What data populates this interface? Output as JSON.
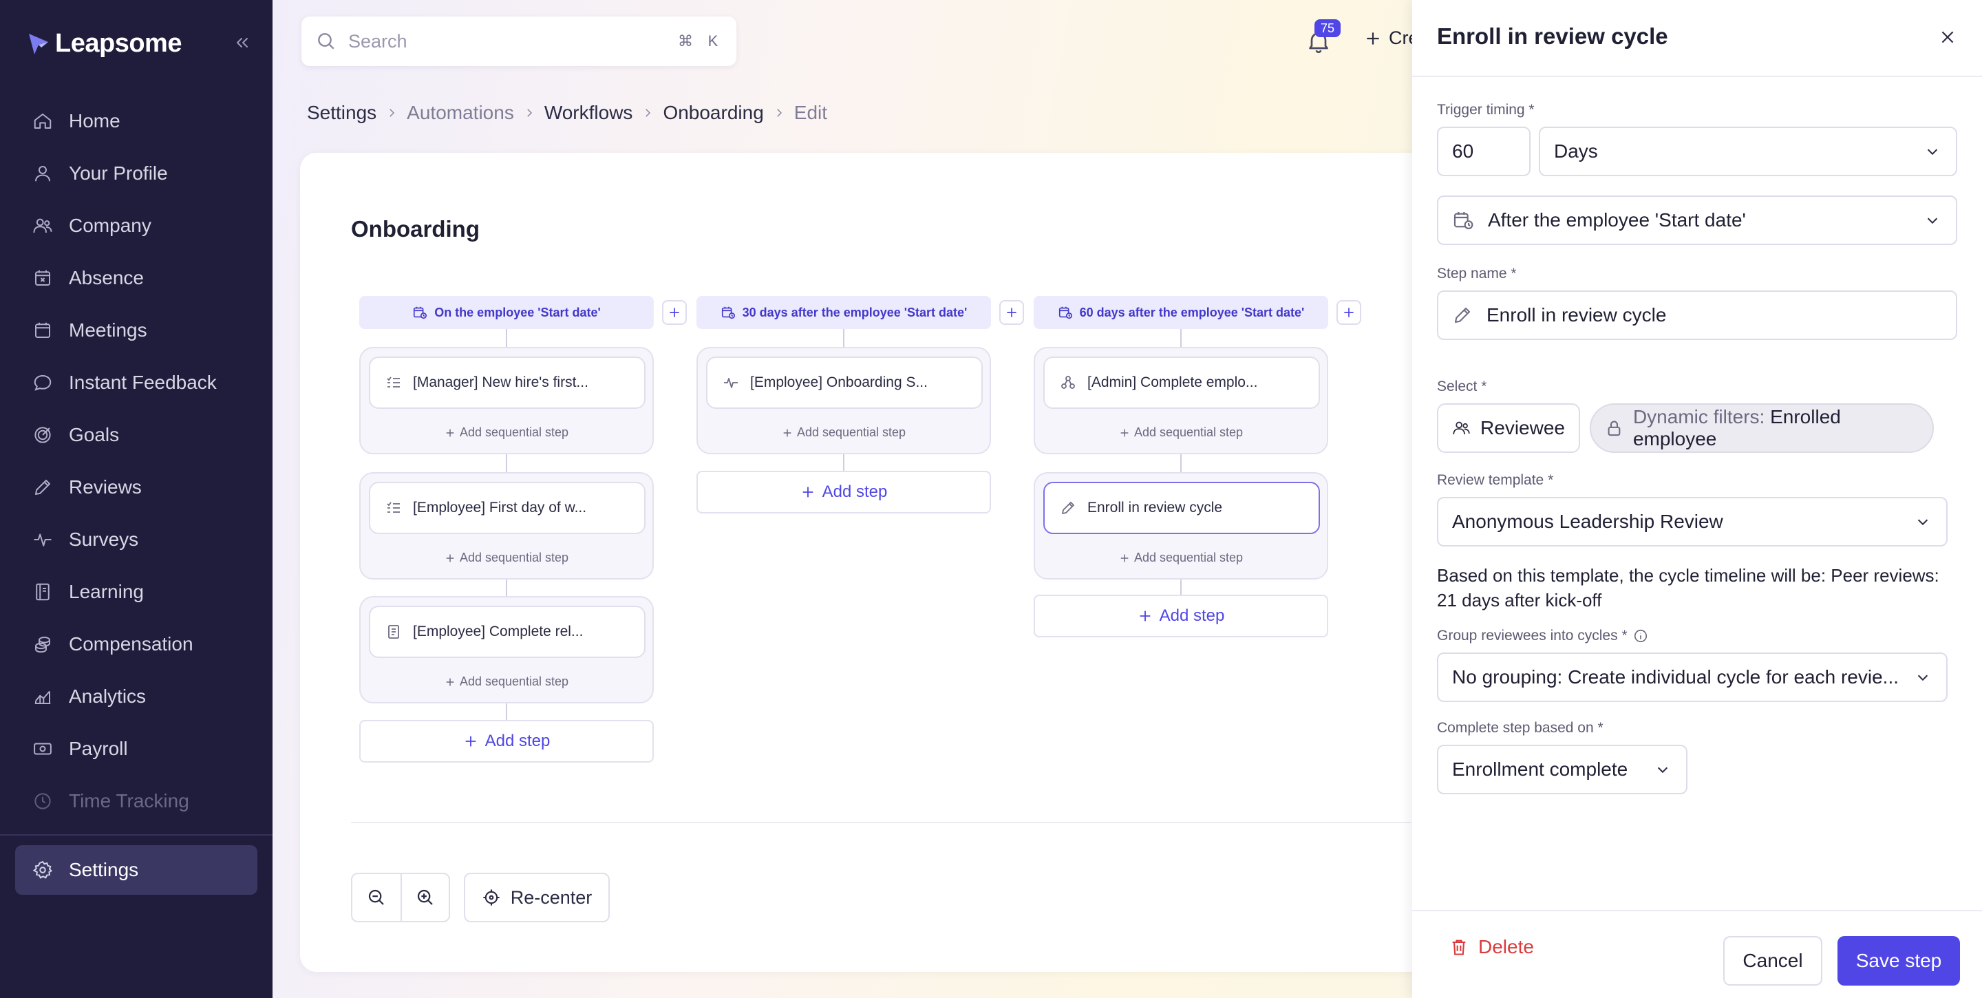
{
  "app": {
    "name": "Leapsome"
  },
  "sidebar": {
    "items": [
      {
        "label": "Home",
        "icon": "home-icon"
      },
      {
        "label": "Your Profile",
        "icon": "user-icon"
      },
      {
        "label": "Company",
        "icon": "people-icon"
      },
      {
        "label": "Absence",
        "icon": "calendar-x-icon"
      },
      {
        "label": "Meetings",
        "icon": "calendar-icon"
      },
      {
        "label": "Instant Feedback",
        "icon": "chat-bubble-icon"
      },
      {
        "label": "Goals",
        "icon": "target-icon"
      },
      {
        "label": "Reviews",
        "icon": "pencil-icon"
      },
      {
        "label": "Surveys",
        "icon": "pulse-icon"
      },
      {
        "label": "Learning",
        "icon": "book-icon"
      },
      {
        "label": "Compensation",
        "icon": "coins-icon"
      },
      {
        "label": "Analytics",
        "icon": "chart-icon"
      },
      {
        "label": "Payroll",
        "icon": "banknote-icon"
      },
      {
        "label": "Time Tracking",
        "icon": "clock-icon",
        "disabled": true
      }
    ],
    "settings_label": "Settings"
  },
  "header": {
    "search_placeholder": "Search",
    "shortcut_mod": "⌘",
    "shortcut_key": "K",
    "notifications_count": "75",
    "create_label": "Cre"
  },
  "breadcrumb": [
    "Settings",
    "Automations",
    "Workflows",
    "Onboarding",
    "Edit"
  ],
  "workflow": {
    "title": "Onboarding",
    "columns": [
      {
        "header": "On the employee 'Start date'",
        "steps": [
          {
            "label": "[Manager] New hire's first...",
            "icon": "checklist-icon"
          },
          {
            "label": "[Employee] First day of w...",
            "icon": "checklist-icon"
          },
          {
            "label": "[Employee] Complete rel...",
            "icon": "document-icon"
          }
        ]
      },
      {
        "header": "30 days after the employee 'Start date'",
        "steps": [
          {
            "label": "[Employee] Onboarding S...",
            "icon": "pulse-icon"
          }
        ]
      },
      {
        "header": "60 days after the employee 'Start date'",
        "steps": [
          {
            "label": "[Admin] Complete emplo...",
            "icon": "org-icon"
          },
          {
            "label": "Enroll in review cycle",
            "icon": "pencil-icon",
            "active": true
          }
        ]
      }
    ],
    "add_sequential_label": "Add sequential step",
    "add_step_label": "Add step",
    "recenter_label": "Re-center"
  },
  "drawer": {
    "title": "Enroll in review cycle",
    "trigger_label": "Trigger timing *",
    "trigger_amount": "60",
    "trigger_unit": "Days",
    "trigger_reference": "After the employee 'Start date'",
    "step_name_label": "Step name *",
    "step_name_value": "Enroll in review cycle",
    "select_label": "Select *",
    "select_reviewee": "Reviewee",
    "dynamic_filter_prefix": "Dynamic filters:",
    "dynamic_filter_value": "Enrolled employee",
    "review_template_label": "Review template *",
    "review_template_value": "Anonymous Leadership Review",
    "timeline_info": "Based on this template, the cycle timeline will be: Peer reviews: 21 days after kick-off",
    "group_label": "Group reviewees into cycles *",
    "group_value": "No grouping: Create individual cycle for each revie...",
    "complete_label": "Complete step based on *",
    "complete_value": "Enrollment complete",
    "delete_label": "Delete",
    "cancel_label": "Cancel",
    "save_label": "Save step"
  },
  "colors": {
    "accent": "#4f46e5",
    "sidebar": "#1f1d3b",
    "danger": "#dc3b3b"
  }
}
